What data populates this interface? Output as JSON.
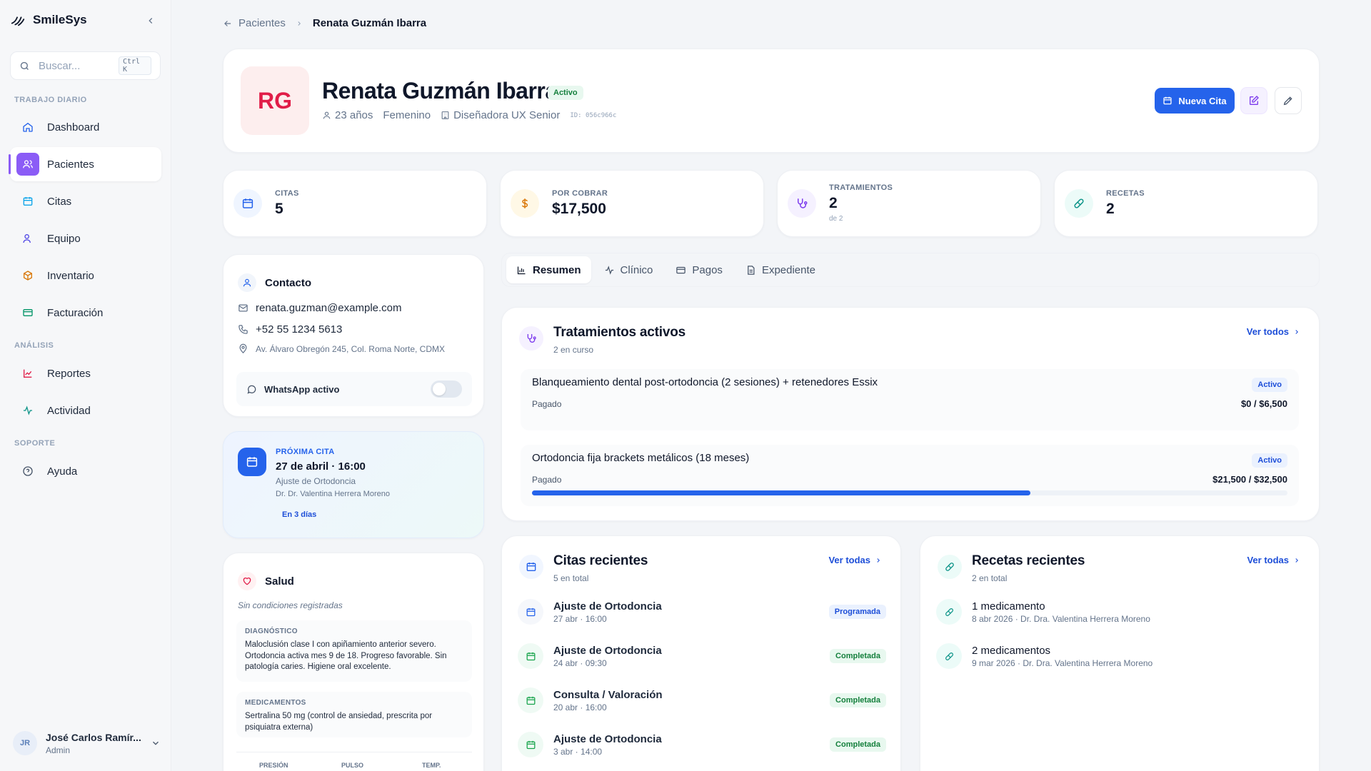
{
  "app": {
    "name": "SmileSys"
  },
  "search": {
    "placeholder": "Buscar...",
    "shortcut": "Ctrl K"
  },
  "sidebar": {
    "sections": {
      "daily": "TRABAJO DIARIO",
      "analysis": "ANÁLISIS",
      "support": "SOPORTE"
    },
    "items": [
      {
        "label": "Dashboard",
        "icon": "home-icon"
      },
      {
        "label": "Pacientes",
        "icon": "users-icon",
        "active": true
      },
      {
        "label": "Citas",
        "icon": "calendar-icon"
      },
      {
        "label": "Equipo",
        "icon": "team-icon"
      },
      {
        "label": "Inventario",
        "icon": "box-icon"
      },
      {
        "label": "Facturación",
        "icon": "credit-card-icon"
      },
      {
        "label": "Reportes",
        "icon": "chart-line-icon"
      },
      {
        "label": "Actividad",
        "icon": "activity-icon"
      },
      {
        "label": "Ayuda",
        "icon": "help-circle-icon"
      }
    ],
    "user": {
      "initials": "JR",
      "name": "José Carlos Ramír...",
      "role": "Admin"
    }
  },
  "breadcrumb": {
    "parent": "Pacientes",
    "current": "Renata Guzmán Ibarra"
  },
  "patient": {
    "initials": "RG",
    "name": "Renata Guzmán Ibarra",
    "status": "Activo",
    "age": "23 años",
    "gender": "Femenino",
    "occupation": "Diseñadora UX Senior",
    "id": "ID: 056c966c",
    "new_appointment": "Nueva Cita"
  },
  "stats": {
    "appointments": {
      "label": "CITAS",
      "value": "5"
    },
    "receivable": {
      "label": "POR COBRAR",
      "value": "$17,500"
    },
    "treatments": {
      "label": "TRATAMIENTOS",
      "value": "2",
      "sub": "de 2"
    },
    "prescriptions": {
      "label": "RECETAS",
      "value": "2"
    }
  },
  "contact": {
    "title": "Contacto",
    "email": "renata.guzman@example.com",
    "phone": "+52 55 1234 5613",
    "address": "Av. Álvaro Obregón 245, Col. Roma Norte, CDMX",
    "whatsapp": "WhatsApp activo"
  },
  "next_appointment": {
    "label": "PRÓXIMA CITA",
    "when": "27 de abril · 16:00",
    "type": "Ajuste de Ortodoncia",
    "doctor": "Dr. Dr. Valentina Herrera Moreno",
    "in": "En 3 días"
  },
  "health": {
    "title": "Salud",
    "conditions": "Sin condiciones registradas",
    "diagnosis_label": "DIAGNÓSTICO",
    "diagnosis": "Maloclusión clase I con apiñamiento anterior severo. Ortodoncia activa mes 9 de 18. Progreso favorable. Sin patología caries. Higiene oral excelente.",
    "meds_label": "MEDICAMENTOS",
    "meds": "Sertralina 50 mg (control de ansiedad, prescrita por psiquiatra externa)",
    "vitals": [
      "PRESIÓN",
      "PULSO",
      "TEMP."
    ]
  },
  "tabs": [
    "Resumen",
    "Clínico",
    "Pagos",
    "Expediente"
  ],
  "treatments": {
    "title": "Tratamientos activos",
    "subtitle": "2 en curso",
    "view_all": "Ver todos",
    "items": [
      {
        "name": "Blanqueamiento dental post-ortodoncia (2 sesiones) + retenedores Essix",
        "status": "Activo",
        "paid_label": "Pagado",
        "amount": "$0 / $6,500",
        "progress": 0
      },
      {
        "name": "Ortodoncia fija brackets metálicos (18 meses)",
        "status": "Activo",
        "paid_label": "Pagado",
        "amount": "$21,500 / $32,500",
        "progress": 0.66
      }
    ]
  },
  "recent_appointments": {
    "title": "Citas recientes",
    "subtitle": "5 en total",
    "view_all": "Ver todas",
    "items": [
      {
        "title": "Ajuste de Ortodoncia",
        "date": "27 abr · 16:00",
        "status": "Programada"
      },
      {
        "title": "Ajuste de Ortodoncia",
        "date": "24 abr · 09:30",
        "status": "Completada"
      },
      {
        "title": "Consulta / Valoración",
        "date": "20 abr · 16:00",
        "status": "Completada"
      },
      {
        "title": "Ajuste de Ortodoncia",
        "date": "3 abr · 14:00",
        "status": "Completada"
      }
    ]
  },
  "recent_prescriptions": {
    "title": "Recetas recientes",
    "subtitle": "2 en total",
    "view_all": "Ver todas",
    "items": [
      {
        "title": "1 medicamento",
        "meta": "8 abr 2026 · Dr. Dra. Valentina Herrera Moreno"
      },
      {
        "title": "2 medicamentos",
        "meta": "9 mar 2026 · Dr. Dra. Valentina Herrera Moreno"
      }
    ]
  },
  "colors": {
    "primary": "#2563eb",
    "accent": "#8b5cf6",
    "success": "#15803d",
    "danger": "#e11d48"
  }
}
